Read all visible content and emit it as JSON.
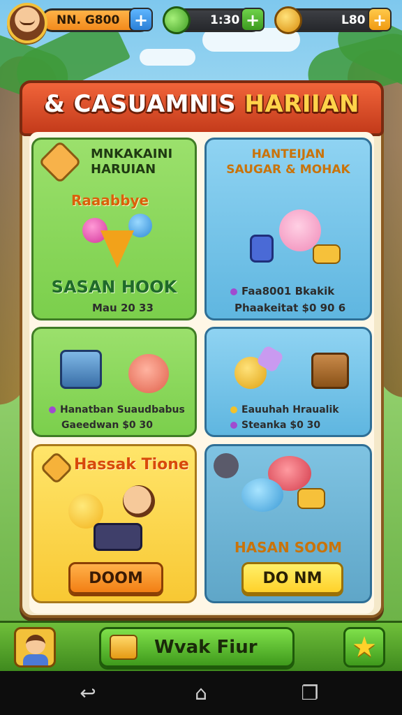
{
  "hud": {
    "player_value": "NN. G800",
    "gems_value": "1:30",
    "coins_value": "L80",
    "plus": "+"
  },
  "panel": {
    "title_prefix": "& CASUAMNIS",
    "title_accent": "HARIIAN"
  },
  "cards": [
    {
      "title": "MNKAKAINI\nHARUIAN",
      "subtitle": "Raaabbye",
      "name": "SASAN HOOK",
      "detail": "Mau 20 33"
    },
    {
      "title": "HANTEIJAN\nSAUGAR & MOHAK",
      "line1": "Faa8001 Bkakik",
      "line2_label": "Phaakeitat",
      "line2_value": "$0 90 6"
    },
    {
      "line1": "Hanatban Suaudbabus",
      "line2_label": "Gaeedwan",
      "line2_value": "$0 30"
    },
    {
      "line1": "Eauuhah Hraualik",
      "line2_label": "Steanka",
      "line2_value": "$0 30"
    },
    {
      "title": "Hassak Tione",
      "button": "DOOM"
    },
    {
      "title": "HASAN SOOM",
      "button": "DO NM"
    }
  ],
  "bottom": {
    "main_button": "Wvak Fiur"
  },
  "colors": {
    "header_red": "#c33a1a",
    "card_green": "#7bcf4c",
    "card_blue": "#5fb6e0",
    "card_yellow": "#f8c833",
    "title_gold": "#ffd34a"
  },
  "icons": {
    "hud": [
      "avatar",
      "plus-icon",
      "gem-icon",
      "coin-icon"
    ],
    "bottom": [
      "player-avatar-icon",
      "treasure-box-icon",
      "star-icon"
    ],
    "nav": [
      "back-icon",
      "home-icon",
      "recent-apps-icon"
    ]
  }
}
